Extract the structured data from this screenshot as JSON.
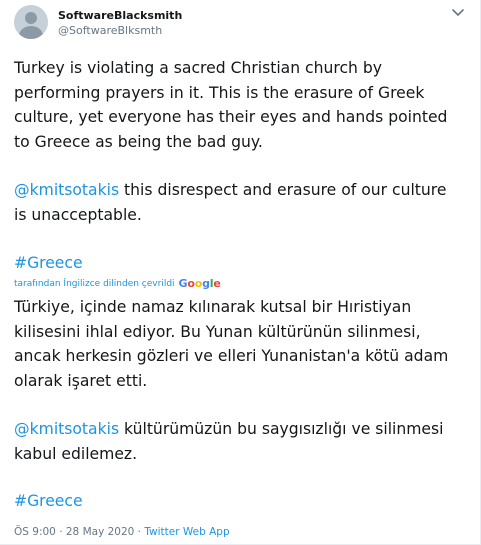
{
  "user": {
    "name": "SoftwareBlacksmith",
    "handle": "@SoftwareBlksmth"
  },
  "tweet": {
    "original": {
      "lines": [
        "Turkey is violating a sacred Christian church by",
        "performing prayers in it. This is the erasure of Greek",
        "culture, yet everyone has their eyes and hands pointed",
        "to Greece as being the bad guy."
      ],
      "mention": "@kmitsotakis",
      "mention_rest_line1": " this disrespect and erasure of our culture",
      "mention_rest_line2": "is unacceptable.",
      "hashtag": "#Greece"
    },
    "translation_notice": "tarafından İngilizce dilinden çevrildi",
    "google_letters": [
      "G",
      "o",
      "o",
      "g",
      "l",
      "e"
    ],
    "translated": {
      "lines": [
        "Türkiye, içinde namaz kılınarak kutsal bir Hıristiyan",
        "kilisesini ihlal ediyor. Bu Yunan kültürünün silinmesi,",
        "ancak herkesin gözleri ve elleri Yunanistan'a kötü adam",
        "olarak işaret etti."
      ],
      "mention": "@kmitsotakis",
      "mention_rest_line1": " kültürümüzün bu saygısızlığı ve silinmesi",
      "mention_rest_line2": "kabul edilemez.",
      "hashtag": "#Greece"
    },
    "time": "ÖS 9:00",
    "separator": " · ",
    "date": "28 May 2020",
    "source": "Twitter Web App"
  },
  "colors": {
    "link": "#1b95e0",
    "text": "#14171a",
    "muted": "#657786",
    "google": [
      "#4285F4",
      "#EA4335",
      "#FBBC05",
      "#4285F4",
      "#34A853",
      "#EA4335"
    ]
  },
  "icons": {
    "avatar": "default-profile-icon",
    "more": "chevron-down-icon"
  }
}
